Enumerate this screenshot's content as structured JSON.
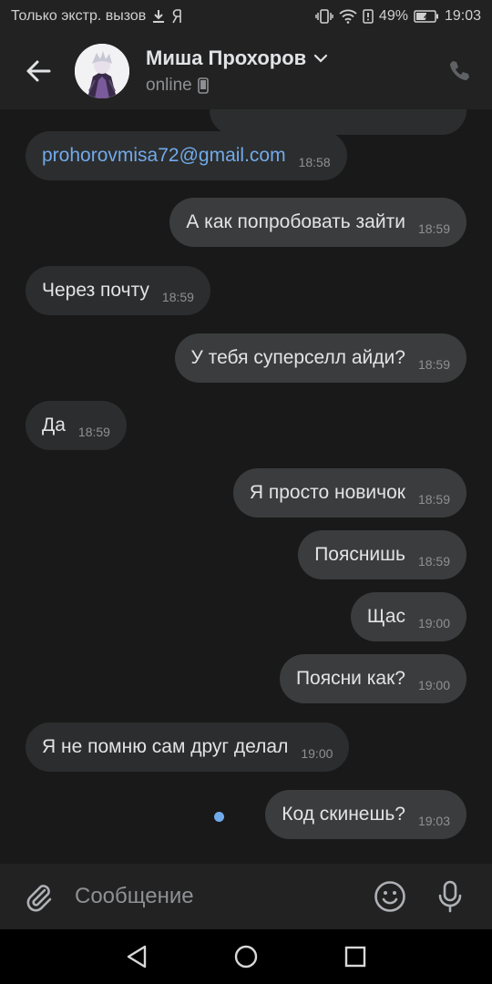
{
  "colors": {
    "background": "#191919",
    "bar": "#222222",
    "bubble_in": "#2c2d2e",
    "bubble_out": "#3b3c3d",
    "link": "#71aaeb",
    "text": "#e1e3e6",
    "muted": "#8e9094"
  },
  "status_bar": {
    "carrier": "Только экстр. вызов",
    "battery": "49%",
    "time": "19:03",
    "icons": [
      "download-icon",
      "yandex-icon",
      "vibrate-icon",
      "wifi-icon",
      "alert-icon",
      "battery-icon"
    ]
  },
  "header": {
    "name": "Миша Прохоров",
    "status": "online",
    "icons": [
      "back-arrow-icon",
      "chevron-down-icon",
      "mobile-phone-icon",
      "call-icon"
    ]
  },
  "messages": [
    {
      "direction": "in",
      "text": "prohorovmisa72@gmail.com",
      "time": "18:58",
      "is_link": true
    },
    {
      "direction": "out",
      "text": "А как попробовать зайти",
      "time": "18:59"
    },
    {
      "direction": "in",
      "text": "Через почту",
      "time": "18:59"
    },
    {
      "direction": "out",
      "text": "У тебя суперселл айди?",
      "time": "18:59"
    },
    {
      "direction": "in",
      "text": "Да",
      "time": "18:59"
    },
    {
      "direction": "out",
      "text": "Я просто новичок",
      "time": "18:59"
    },
    {
      "direction": "out",
      "text": "Пояснишь",
      "time": "18:59"
    },
    {
      "direction": "out",
      "text": "Щас",
      "time": "19:00"
    },
    {
      "direction": "out",
      "text": "Поясни как?",
      "time": "19:00"
    },
    {
      "direction": "in",
      "text": "Я не помню сам друг делал",
      "time": "19:00"
    },
    {
      "direction": "out",
      "text": "Код скинешь?",
      "time": "19:03",
      "unread": true
    }
  ],
  "composer": {
    "placeholder": "Сообщение",
    "icons": [
      "paperclip-icon",
      "emoji-icon",
      "microphone-icon"
    ]
  },
  "nav_bar": {
    "icons": [
      "back-triangle-icon",
      "home-circle-icon",
      "recents-square-icon"
    ]
  }
}
